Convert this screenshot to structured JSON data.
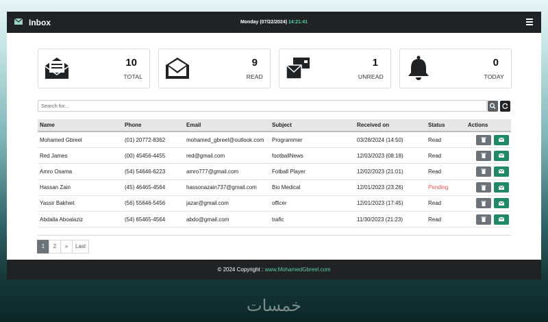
{
  "header": {
    "title": "Inbox",
    "date": "Monday (07/22/2024)",
    "time": "14:21:41"
  },
  "cards": [
    {
      "count": "10",
      "label": "TOTAL",
      "icon": "envelope-open-letter-icon"
    },
    {
      "count": "9",
      "label": "READ",
      "icon": "envelope-open-icon"
    },
    {
      "count": "1",
      "label": "UNREAD",
      "icon": "envelopes-bulk-icon"
    },
    {
      "count": "0",
      "label": "TODAY",
      "icon": "bell-icon"
    }
  ],
  "search": {
    "placeholder": "Search for..."
  },
  "table": {
    "headers": [
      "Name",
      "Phone",
      "Email",
      "Subject",
      "Received on",
      "Status",
      "Actions"
    ],
    "rows": [
      {
        "name": "Mohamed Gbreel",
        "phone": "(01) 20772-8362",
        "email": "mohamed_gbreel@outlook.com",
        "subject": "Programmer",
        "received": "03/28/2024 (14:50)",
        "status": "Read"
      },
      {
        "name": "Red James",
        "phone": "(00) 45456-4455",
        "email": "red@gmail.com",
        "subject": "footballNews",
        "received": "12/03/2023 (08:18)",
        "status": "Read"
      },
      {
        "name": "Amro Osama",
        "phone": "(54) 54646-6223",
        "email": "amro777@gmail.com",
        "subject": "Fotball Player",
        "received": "12/02/2023 (21:01)",
        "status": "Read"
      },
      {
        "name": "Hassan Zain",
        "phone": "(45) 46465-4564",
        "email": "hassonazain737@gmail.com",
        "subject": "Bio Medical",
        "received": "12/01/2023 (23:26)",
        "status": "Pending"
      },
      {
        "name": "Yassir Bakhiet",
        "phone": "(56) 55646-5456",
        "email": "jazar@gmail.com",
        "subject": "officer",
        "received": "12/01/2023 (17:45)",
        "status": "Read"
      },
      {
        "name": "Abdalla Aboalaziz",
        "phone": "(54) 65465-4564",
        "email": "abdo@gmail.com",
        "subject": "trafic",
        "received": "11/30/2023 (21:23)",
        "status": "Read"
      }
    ]
  },
  "pagination": {
    "pages": [
      "1",
      "2"
    ],
    "next": "»",
    "last": "Last",
    "active": "1"
  },
  "footer": {
    "copyright": "© 2024 Copyright : ",
    "link": "www.MohamedGbreel.com"
  },
  "watermark": "خمسات",
  "colors": {
    "dark": "#1f2326",
    "accent_green": "#1f8a63",
    "time_green": "#5fcf9e",
    "pending_red": "#e0554f",
    "button_gray": "#6c7378"
  }
}
